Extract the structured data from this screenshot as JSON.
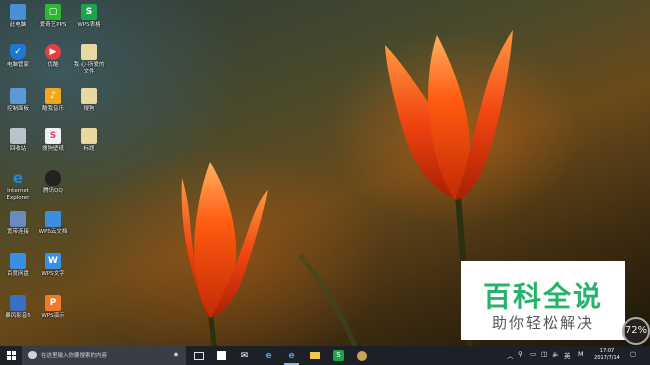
{
  "desktop": {
    "icons": [
      {
        "label": "此电脑",
        "icon": "computer-icon",
        "color": "#4a8fd4"
      },
      {
        "label": "爱奇艺PPS",
        "icon": "iqiyi-icon",
        "color": "#2eb82e"
      },
      {
        "label": "WPS表格",
        "icon": "wps-sheet-icon",
        "color": "#1aa54a"
      },
      {
        "label": "电脑管家",
        "icon": "shield-icon",
        "color": "#1e78d2"
      },
      {
        "label": "优酷",
        "icon": "youku-icon",
        "color": "#e04040"
      },
      {
        "label": "我·心·所爱的文件",
        "icon": "file-icon",
        "color": "#e8d9a0"
      },
      {
        "label": "控制面板",
        "icon": "control-panel-icon",
        "color": "#5a9ad6"
      },
      {
        "label": "酷我音乐",
        "icon": "kuwo-icon",
        "color": "#f2a71c"
      },
      {
        "label": "搜狗",
        "icon": "document-icon",
        "color": "#e8d9a0"
      },
      {
        "label": "回收站",
        "icon": "recycle-bin-icon",
        "color": "#b8c4cc"
      },
      {
        "label": "搜狗壁纸",
        "icon": "sogou-wallpaper-icon",
        "color": "#f0f0f0"
      },
      {
        "label": "标题",
        "icon": "document-icon",
        "color": "#e8d9a0"
      },
      {
        "label": "Internet Explorer",
        "icon": "ie-icon",
        "color": "#1f8ad8"
      },
      {
        "label": "腾讯QQ",
        "icon": "qq-icon",
        "color": "#222222"
      },
      {
        "label": "宽带连接",
        "icon": "broadband-icon",
        "color": "#6a8bc0"
      },
      {
        "label": "WPS云文档",
        "icon": "wps-cloud-icon",
        "color": "#3b8fe0"
      },
      {
        "label": "百度网盘",
        "icon": "baidu-pan-icon",
        "color": "#3b8fe0"
      },
      {
        "label": "WPS文字",
        "icon": "wps-writer-icon",
        "color": "#3b8fe0"
      },
      {
        "label": "暴风影音5",
        "icon": "storm-player-icon",
        "color": "#3b6fc0"
      },
      {
        "label": "WPS演示",
        "icon": "wps-slides-icon",
        "color": "#f07a2a"
      }
    ]
  },
  "watermark": {
    "title": "百科全说",
    "subtitle": "助你轻松解决",
    "title_color": "#27b36b"
  },
  "gauge": {
    "value": "72"
  },
  "taskbar": {
    "search_placeholder": "在这里输入你要搜索的内容",
    "tray": {
      "ime_mode": "英",
      "ime_letter": "M"
    },
    "clock": {
      "time": "17:07",
      "date": "2017/7/14"
    }
  }
}
